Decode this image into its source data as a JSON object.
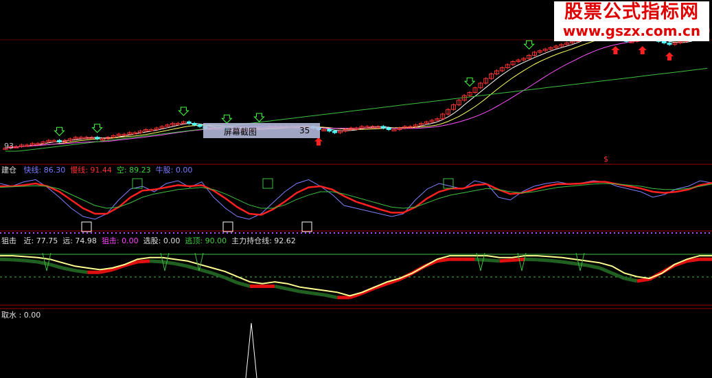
{
  "watermark": {
    "line1": "股票公式指标网",
    "line2": "www.gszx.com.cn"
  },
  "tooltip": {
    "label": "屏幕截图",
    "value": "35"
  },
  "main_panel": {
    "left_value": "93",
    "dollar_mark": "$"
  },
  "panel1": {
    "title": "建仓",
    "fields": [
      {
        "label": "快线:",
        "value": "86.30",
        "color": "#7b7bff"
      },
      {
        "label": "慢线:",
        "value": "91.44",
        "color": "#ff3030"
      },
      {
        "label": "空:",
        "value": "89.23",
        "color": "#40d040"
      },
      {
        "label": "牛股:",
        "value": "0.00",
        "color": "#7b7bff"
      }
    ]
  },
  "panel2": {
    "title": "狙击",
    "fields": [
      {
        "label": "近:",
        "value": "77.75",
        "color": "#e0e0e0"
      },
      {
        "label": "远:",
        "value": "74.98",
        "color": "#e0e0e0"
      },
      {
        "label": "狙击:",
        "value": "0.00",
        "color": "#ff40ff"
      },
      {
        "label": "选股:",
        "value": "0.00",
        "color": "#e0e0e0"
      },
      {
        "label": "逃顶:",
        "value": "90.00",
        "color": "#40d040"
      },
      {
        "label": "主力持仓线:",
        "value": "92.62",
        "color": "#e0e0e0"
      }
    ]
  },
  "panel3": {
    "title": "取水",
    "value": ": 0.00"
  },
  "colors": {
    "up": "#ff3232",
    "down": "#54ffff",
    "ma_fast": "#ffffff",
    "ma_mid": "#ffff60",
    "ma_slow": "#ff50ff",
    "ma_long": "#40c040",
    "divider": "#a00000",
    "fast_line": "#8080ff",
    "slow_line": "#ff2020",
    "empty_line": "#40c040"
  },
  "chart_data": [
    {
      "type": "candlestick",
      "title": "",
      "close": [
        22,
        23,
        23,
        24,
        24,
        25,
        25,
        26,
        27,
        27,
        26,
        27,
        28,
        29,
        29,
        29,
        29,
        28,
        28,
        29,
        30,
        31,
        31,
        32,
        32,
        33,
        34,
        34,
        35,
        36,
        37,
        38,
        38,
        39,
        38,
        37,
        36,
        35,
        35,
        35,
        35,
        34,
        34,
        34,
        34,
        34,
        34,
        35,
        35,
        36,
        36,
        36,
        36,
        36,
        36,
        36,
        36,
        35,
        34,
        34,
        33,
        32,
        33,
        34,
        35,
        35,
        36,
        36,
        36,
        36,
        35,
        34,
        34,
        35,
        36,
        36,
        37,
        38,
        39,
        40,
        41,
        44,
        47,
        50,
        53,
        56,
        58,
        61,
        64,
        67,
        70,
        72,
        74,
        76,
        78,
        79,
        80,
        82,
        84,
        85,
        86,
        87,
        88,
        89,
        90,
        91,
        93,
        95,
        96,
        97,
        96,
        95,
        94,
        93,
        92,
        91,
        91,
        92,
        93,
        93,
        92,
        91,
        90,
        89,
        90,
        91,
        92,
        93,
        95,
        97,
        99
      ],
      "ylim": [
        20,
        100
      ]
    },
    {
      "type": "line",
      "title": "",
      "series": [
        {
          "name": "快线",
          "values": [
            85,
            80,
            88,
            92,
            78,
            60,
            40,
            25,
            20,
            30,
            55,
            75,
            80,
            70,
            85,
            90,
            78,
            88,
            60,
            40,
            25,
            20,
            30,
            50,
            70,
            85,
            92,
            80,
            65,
            45,
            40,
            35,
            30,
            25,
            30,
            55,
            75,
            85,
            80,
            75,
            90,
            85,
            60,
            55,
            70,
            80,
            85,
            88,
            84,
            86,
            90,
            88,
            80,
            75,
            70,
            60,
            65,
            75,
            80,
            90,
            86
          ]
        },
        {
          "name": "慢线",
          "values": [
            80,
            80,
            82,
            85,
            80,
            70,
            55,
            40,
            30,
            30,
            42,
            60,
            72,
            74,
            78,
            82,
            80,
            82,
            72,
            58,
            42,
            30,
            28,
            38,
            52,
            68,
            78,
            80,
            74,
            62,
            52,
            45,
            38,
            32,
            32,
            42,
            58,
            70,
            76,
            76,
            82,
            84,
            74,
            66,
            68,
            74,
            80,
            84,
            84,
            85,
            88,
            88,
            84,
            80,
            76,
            70,
            68,
            70,
            74,
            82,
            86
          ]
        },
        {
          "name": "空",
          "values": [
            78,
            79,
            80,
            81,
            80,
            75,
            65,
            55,
            45,
            40,
            42,
            50,
            60,
            66,
            70,
            74,
            76,
            78,
            74,
            66,
            56,
            46,
            40,
            40,
            46,
            56,
            64,
            70,
            70,
            66,
            60,
            54,
            48,
            42,
            40,
            42,
            50,
            58,
            64,
            68,
            72,
            76,
            74,
            70,
            68,
            70,
            74,
            78,
            80,
            82,
            84,
            85,
            84,
            82,
            80,
            76,
            74,
            74,
            76,
            80,
            84
          ]
        }
      ],
      "ylim": [
        0,
        100
      ]
    },
    {
      "type": "line",
      "title": "",
      "series": [
        {
          "name": "近",
          "values": [
            92,
            92,
            91,
            90,
            88,
            84,
            80,
            78,
            76,
            78,
            82,
            88,
            90,
            90,
            88,
            86,
            82,
            78,
            74,
            68,
            62,
            60,
            62,
            60,
            56,
            54,
            52,
            50,
            46,
            50,
            56,
            62,
            66,
            72,
            80,
            88,
            92,
            92,
            92,
            92,
            90,
            90,
            92,
            92,
            91,
            90,
            88,
            86,
            84,
            80,
            72,
            68,
            66,
            72,
            82,
            88,
            92,
            92
          ]
        },
        {
          "name": "主力持仓线",
          "values": [
            80,
            80,
            80,
            80,
            80,
            80,
            80,
            80,
            80,
            80,
            80,
            80,
            80,
            80,
            80,
            80,
            80,
            80,
            80,
            80,
            80,
            80,
            80,
            80,
            80,
            80,
            80,
            80,
            80,
            80,
            80,
            80,
            80,
            80,
            80,
            80,
            80,
            80,
            80,
            80,
            80,
            80,
            80,
            80,
            80,
            80,
            80,
            80,
            80,
            80,
            80,
            80,
            80,
            80,
            80,
            80,
            80,
            92
          ]
        }
      ],
      "ylim": [
        40,
        100
      ]
    }
  ]
}
